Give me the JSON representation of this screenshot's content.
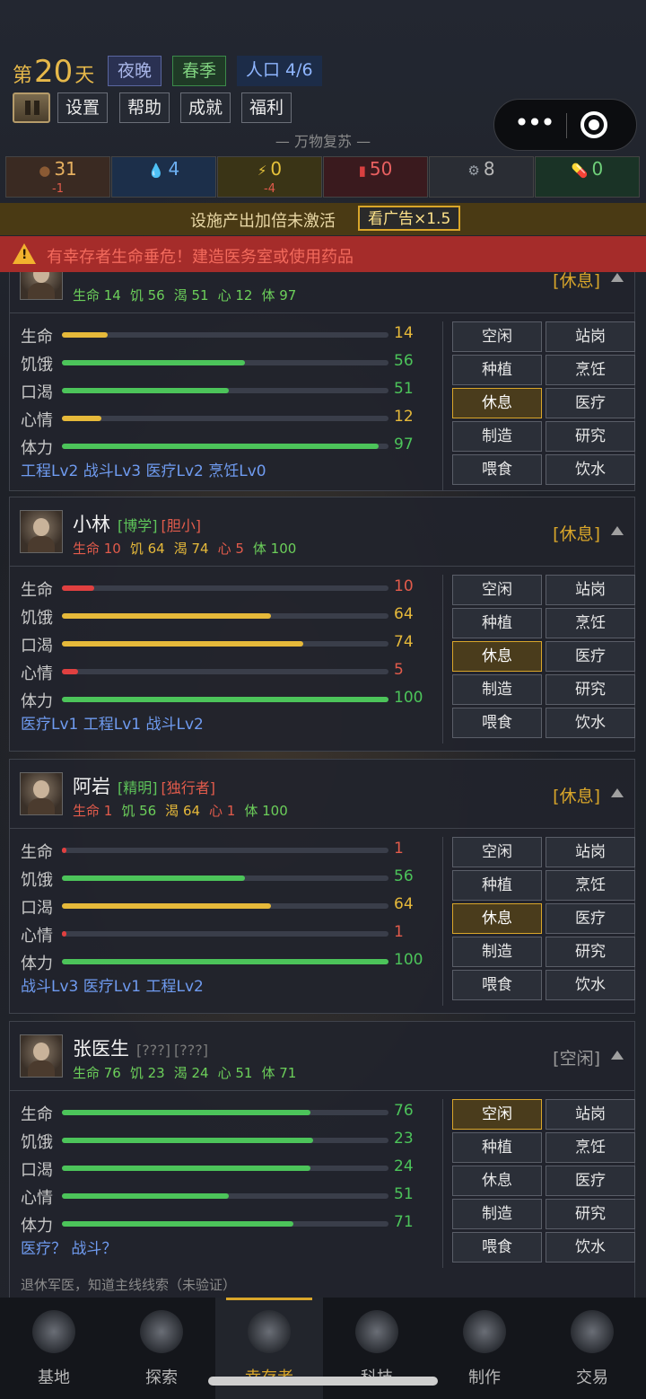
{
  "header": {
    "day_prefix": "第",
    "day_num": "20",
    "day_suffix": "天",
    "time_of_day": "夜晚",
    "season": "春季",
    "population": "人口 4/6",
    "menu": [
      "设置",
      "帮助",
      "成就",
      "福利"
    ],
    "motto": "— 万物复苏 —"
  },
  "resources": [
    {
      "icon": "food-icon",
      "glyph": "●",
      "color": "#8a5a34",
      "value": "31",
      "delta": "-1",
      "bg": "#3a2a22"
    },
    {
      "icon": "water-drop-icon",
      "glyph": "💧",
      "color": "#4a9be8",
      "value": "4",
      "delta": "",
      "bg": "#1c2f4a"
    },
    {
      "icon": "energy-icon",
      "glyph": "⚡",
      "color": "#e6c23a",
      "value": "0",
      "delta": "-4",
      "bg": "#3a3416"
    },
    {
      "icon": "fuel-can-icon",
      "glyph": "▮",
      "color": "#d94040",
      "value": "50",
      "delta": "",
      "bg": "#3a1a1e"
    },
    {
      "icon": "gear-icon",
      "glyph": "⚙",
      "color": "#9aa0a8",
      "value": "8",
      "delta": "",
      "bg": "#2a2d34"
    },
    {
      "icon": "pill-icon",
      "glyph": "💊",
      "color": "#58c070",
      "value": "0",
      "delta": "",
      "bg": "#1a3326"
    }
  ],
  "boost": {
    "text": "设施产出加倍未激活",
    "button": "看广告×1.5"
  },
  "alert": {
    "text": "有幸存者生命垂危！建造医务室或使用药品"
  },
  "stat_labels": [
    "生命",
    "饥饿",
    "口渴",
    "心情",
    "体力"
  ],
  "actions": [
    "空闲",
    "站岗",
    "种植",
    "烹饪",
    "休息",
    "医疗",
    "制造",
    "研究",
    "喂食",
    "饮水"
  ],
  "survivors": [
    {
      "name": "",
      "traits": [],
      "state": "[休息]",
      "stats_line": [
        {
          "k": "生命",
          "v": "14",
          "c": "#6ccf5a"
        },
        {
          "k": "饥",
          "v": "56",
          "c": "#6ccf5a"
        },
        {
          "k": "渴",
          "v": "51",
          "c": "#6ccf5a"
        },
        {
          "k": "心",
          "v": "12",
          "c": "#6ccf5a"
        },
        {
          "k": "体",
          "v": "97",
          "c": "#6ccf5a"
        }
      ],
      "bars": [
        14,
        56,
        51,
        12,
        97
      ],
      "bar_colors": [
        "#e6b93a",
        "#4cc45a",
        "#4cc45a",
        "#e6b93a",
        "#4cc45a"
      ],
      "val_colors": [
        "#e6b93a",
        "#4cc45a",
        "#4cc45a",
        "#e6b93a",
        "#4cc45a"
      ],
      "skills": "工程Lv2  战斗Lv3  医疗Lv2  烹饪Lv0",
      "active": "休息"
    },
    {
      "name": "小林",
      "traits": [
        {
          "t": "[博学]",
          "c": "#5ec45a"
        },
        {
          "t": "[胆小]",
          "c": "#e25b4b"
        }
      ],
      "state": "[休息]",
      "stats_line": [
        {
          "k": "生命",
          "v": "10",
          "c": "#e25b4b"
        },
        {
          "k": "饥",
          "v": "64",
          "c": "#e6b93a"
        },
        {
          "k": "渴",
          "v": "74",
          "c": "#e6b93a"
        },
        {
          "k": "心",
          "v": "5",
          "c": "#e25b4b"
        },
        {
          "k": "体",
          "v": "100",
          "c": "#6ccf5a"
        }
      ],
      "bars": [
        10,
        64,
        74,
        5,
        100
      ],
      "bar_colors": [
        "#e04040",
        "#e6b93a",
        "#e6b93a",
        "#e04040",
        "#4cc45a"
      ],
      "val_colors": [
        "#e25b4b",
        "#e6b93a",
        "#e6b93a",
        "#e25b4b",
        "#4cc45a"
      ],
      "skills": "医疗Lv1  工程Lv1  战斗Lv2",
      "active": "休息"
    },
    {
      "name": "阿岩",
      "traits": [
        {
          "t": "[精明]",
          "c": "#5ec45a"
        },
        {
          "t": "[独行者]",
          "c": "#e25b4b"
        }
      ],
      "state": "[休息]",
      "stats_line": [
        {
          "k": "生命",
          "v": "1",
          "c": "#e25b4b"
        },
        {
          "k": "饥",
          "v": "56",
          "c": "#6ccf5a"
        },
        {
          "k": "渴",
          "v": "64",
          "c": "#e6b93a"
        },
        {
          "k": "心",
          "v": "1",
          "c": "#e25b4b"
        },
        {
          "k": "体",
          "v": "100",
          "c": "#6ccf5a"
        }
      ],
      "bars": [
        1,
        56,
        64,
        1,
        100
      ],
      "bar_colors": [
        "#e04040",
        "#4cc45a",
        "#e6b93a",
        "#e04040",
        "#4cc45a"
      ],
      "val_colors": [
        "#e25b4b",
        "#4cc45a",
        "#e6b93a",
        "#e25b4b",
        "#4cc45a"
      ],
      "skills": "战斗Lv3  医疗Lv1  工程Lv2",
      "active": "休息"
    },
    {
      "name": "张医生",
      "traits": [
        {
          "t": "[???]",
          "c": "#7a7a7a"
        },
        {
          "t": "[???]",
          "c": "#7a7a7a"
        }
      ],
      "state": "[空闲]",
      "stats_line": [
        {
          "k": "生命",
          "v": "76",
          "c": "#6ccf5a"
        },
        {
          "k": "饥",
          "v": "23",
          "c": "#6ccf5a"
        },
        {
          "k": "渴",
          "v": "24",
          "c": "#6ccf5a"
        },
        {
          "k": "心",
          "v": "51",
          "c": "#6ccf5a"
        },
        {
          "k": "体",
          "v": "71",
          "c": "#6ccf5a"
        }
      ],
      "bars": [
        76,
        77,
        76,
        51,
        71
      ],
      "bar_colors": [
        "#4cc45a",
        "#4cc45a",
        "#4cc45a",
        "#4cc45a",
        "#4cc45a"
      ],
      "val_colors": [
        "#4cc45a",
        "#4cc45a",
        "#4cc45a",
        "#4cc45a",
        "#4cc45a"
      ],
      "bar_values": [
        "76",
        "23",
        "24",
        "51",
        "71"
      ],
      "skills": "医疗？ 战斗？",
      "note": "退休军医，知道主线线索（未验证）",
      "active": "空闲"
    }
  ],
  "nav": [
    {
      "label": "基地",
      "icon": "base-icon"
    },
    {
      "label": "探索",
      "icon": "compass-icon"
    },
    {
      "label": "幸存者",
      "icon": "survivors-icon",
      "active": true
    },
    {
      "label": "科技",
      "icon": "tech-gear-icon"
    },
    {
      "label": "制作",
      "icon": "craft-icon"
    },
    {
      "label": "交易",
      "icon": "trade-icon"
    }
  ]
}
